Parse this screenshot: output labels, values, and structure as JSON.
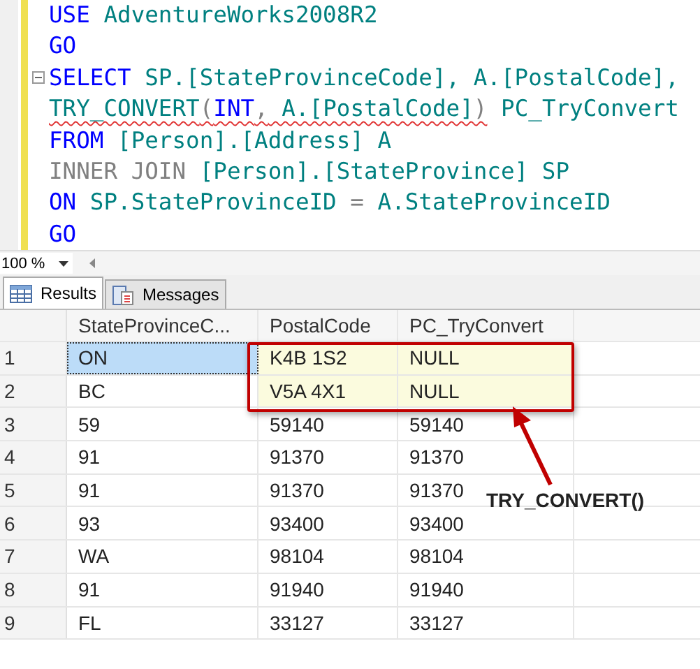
{
  "editor": {
    "lines": [
      {
        "collapsible": false,
        "tokens": [
          {
            "kind": "kw",
            "text": "USE"
          },
          {
            "kind": "id",
            "text": " AdventureWorks2008R2"
          }
        ]
      },
      {
        "collapsible": false,
        "tokens": [
          {
            "kind": "kw",
            "text": "GO"
          }
        ]
      },
      {
        "collapsible": true,
        "tokens": [
          {
            "kind": "kw",
            "text": "SELECT"
          },
          {
            "kind": "id",
            "text": " SP.[StateProvinceCode], A.[PostalCode],"
          }
        ]
      },
      {
        "collapsible": false,
        "tokens": [
          {
            "kind": "id",
            "text": "TRY_CONVERT",
            "error": true
          },
          {
            "kind": "op",
            "text": "(",
            "error": true
          },
          {
            "kind": "kw",
            "text": "INT",
            "error": true
          },
          {
            "kind": "op",
            "text": ",",
            "error": true
          },
          {
            "kind": "id",
            "text": " A.[PostalCode]",
            "error": true
          },
          {
            "kind": "op",
            "text": ")",
            "error": true
          },
          {
            "kind": "id",
            "text": " PC_TryConvert"
          }
        ]
      },
      {
        "collapsible": false,
        "tokens": [
          {
            "kind": "kw",
            "text": "FROM"
          },
          {
            "kind": "id",
            "text": " [Person].[Address] A"
          }
        ]
      },
      {
        "collapsible": false,
        "tokens": [
          {
            "kind": "op",
            "text": "INNER JOIN"
          },
          {
            "kind": "id",
            "text": " [Person].[StateProvince] SP"
          }
        ]
      },
      {
        "collapsible": false,
        "tokens": [
          {
            "kind": "kw",
            "text": "ON"
          },
          {
            "kind": "id",
            "text": " SP.StateProvinceID "
          },
          {
            "kind": "op",
            "text": "="
          },
          {
            "kind": "id",
            "text": " A.StateProvinceID"
          }
        ]
      },
      {
        "collapsible": false,
        "tokens": [
          {
            "kind": "kw",
            "text": "GO"
          }
        ]
      }
    ]
  },
  "zoom": {
    "value": "100 %"
  },
  "tabs": [
    {
      "label": "Results",
      "kind": "grid",
      "selected": true
    },
    {
      "label": "Messages",
      "kind": "messages",
      "selected": false
    }
  ],
  "grid": {
    "columns": [
      "StateProvinceC...",
      "PostalCode",
      "PC_TryConvert"
    ],
    "rows": [
      {
        "number": "1",
        "cells": [
          "ON",
          "K4B 1S2",
          "NULL"
        ],
        "selected": true,
        "highlighted": true
      },
      {
        "number": "2",
        "cells": [
          "BC",
          "V5A 4X1",
          "NULL"
        ],
        "selected": false,
        "highlighted": true
      },
      {
        "number": "3",
        "cells": [
          "59",
          "59140",
          "59140"
        ],
        "selected": false,
        "highlighted": false
      },
      {
        "number": "4",
        "cells": [
          "91",
          "91370",
          "91370"
        ],
        "selected": false,
        "highlighted": false
      },
      {
        "number": "5",
        "cells": [
          "91",
          "91370",
          "91370"
        ],
        "selected": false,
        "highlighted": false
      },
      {
        "number": "6",
        "cells": [
          "93",
          "93400",
          "93400"
        ],
        "selected": false,
        "highlighted": false
      },
      {
        "number": "7",
        "cells": [
          "WA",
          "98104",
          "98104"
        ],
        "selected": false,
        "highlighted": false
      },
      {
        "number": "8",
        "cells": [
          "91",
          "91940",
          "91940"
        ],
        "selected": false,
        "highlighted": false
      },
      {
        "number": "9",
        "cells": [
          "FL",
          "33127",
          "33127"
        ],
        "selected": false,
        "highlighted": false
      }
    ]
  },
  "annotation": {
    "label": "TRY_CONVERT()"
  }
}
